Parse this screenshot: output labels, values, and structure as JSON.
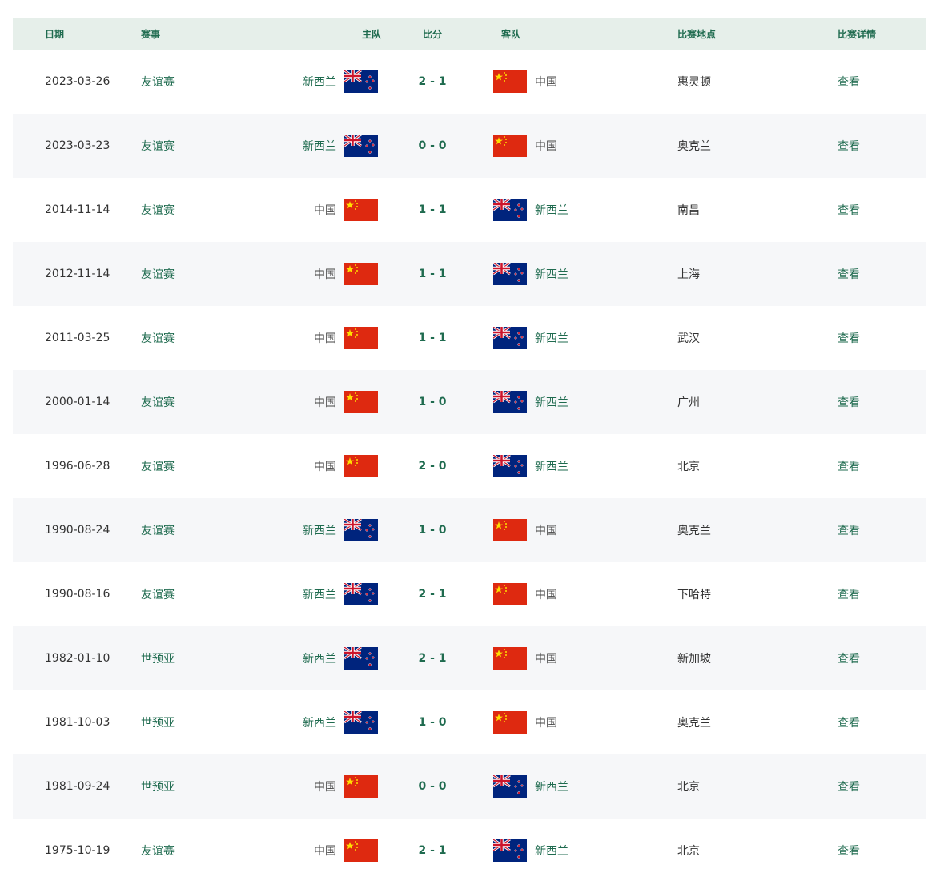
{
  "headers": {
    "date": "日期",
    "event": "赛事",
    "home": "主队",
    "score": "比分",
    "away": "客队",
    "venue": "比赛地点",
    "detail": "比赛详情"
  },
  "colors": {
    "accent": "#1f6b4f",
    "header_bg": "#e6efea",
    "row_alt_bg": "#f6f7f9",
    "cn_red": "#de2910",
    "cn_yellow": "#ffde00",
    "nz_blue": "#00247d",
    "nz_red": "#cc142b"
  },
  "rows": [
    {
      "date": "2023-03-26",
      "event": "友谊赛",
      "home": {
        "name": "新西兰",
        "flag": "nz"
      },
      "score": "2 - 1",
      "away": {
        "name": "中国",
        "flag": "cn"
      },
      "venue": "惠灵顿",
      "detail": "查看"
    },
    {
      "date": "2023-03-23",
      "event": "友谊赛",
      "home": {
        "name": "新西兰",
        "flag": "nz"
      },
      "score": "0 - 0",
      "away": {
        "name": "中国",
        "flag": "cn"
      },
      "venue": "奥克兰",
      "detail": "查看"
    },
    {
      "date": "2014-11-14",
      "event": "友谊赛",
      "home": {
        "name": "中国",
        "flag": "cn"
      },
      "score": "1 - 1",
      "away": {
        "name": "新西兰",
        "flag": "nz"
      },
      "venue": "南昌",
      "detail": "查看"
    },
    {
      "date": "2012-11-14",
      "event": "友谊赛",
      "home": {
        "name": "中国",
        "flag": "cn"
      },
      "score": "1 - 1",
      "away": {
        "name": "新西兰",
        "flag": "nz"
      },
      "venue": "上海",
      "detail": "查看"
    },
    {
      "date": "2011-03-25",
      "event": "友谊赛",
      "home": {
        "name": "中国",
        "flag": "cn"
      },
      "score": "1 - 1",
      "away": {
        "name": "新西兰",
        "flag": "nz"
      },
      "venue": "武汉",
      "detail": "查看"
    },
    {
      "date": "2000-01-14",
      "event": "友谊赛",
      "home": {
        "name": "中国",
        "flag": "cn"
      },
      "score": "1 - 0",
      "away": {
        "name": "新西兰",
        "flag": "nz"
      },
      "venue": "广州",
      "detail": "查看"
    },
    {
      "date": "1996-06-28",
      "event": "友谊赛",
      "home": {
        "name": "中国",
        "flag": "cn"
      },
      "score": "2 - 0",
      "away": {
        "name": "新西兰",
        "flag": "nz"
      },
      "venue": "北京",
      "detail": "查看"
    },
    {
      "date": "1990-08-24",
      "event": "友谊赛",
      "home": {
        "name": "新西兰",
        "flag": "nz"
      },
      "score": "1 - 0",
      "away": {
        "name": "中国",
        "flag": "cn"
      },
      "venue": "奥克兰",
      "detail": "查看"
    },
    {
      "date": "1990-08-16",
      "event": "友谊赛",
      "home": {
        "name": "新西兰",
        "flag": "nz"
      },
      "score": "2 - 1",
      "away": {
        "name": "中国",
        "flag": "cn"
      },
      "venue": "下哈特",
      "detail": "查看"
    },
    {
      "date": "1982-01-10",
      "event": "世预亚",
      "home": {
        "name": "新西兰",
        "flag": "nz"
      },
      "score": "2 - 1",
      "away": {
        "name": "中国",
        "flag": "cn"
      },
      "venue": "新加坡",
      "detail": "查看"
    },
    {
      "date": "1981-10-03",
      "event": "世预亚",
      "home": {
        "name": "新西兰",
        "flag": "nz"
      },
      "score": "1 - 0",
      "away": {
        "name": "中国",
        "flag": "cn"
      },
      "venue": "奥克兰",
      "detail": "查看"
    },
    {
      "date": "1981-09-24",
      "event": "世预亚",
      "home": {
        "name": "中国",
        "flag": "cn"
      },
      "score": "0 - 0",
      "away": {
        "name": "新西兰",
        "flag": "nz"
      },
      "venue": "北京",
      "detail": "查看"
    },
    {
      "date": "1975-10-19",
      "event": "友谊赛",
      "home": {
        "name": "中国",
        "flag": "cn"
      },
      "score": "2 - 1",
      "away": {
        "name": "新西兰",
        "flag": "nz"
      },
      "venue": "北京",
      "detail": "查看"
    }
  ]
}
